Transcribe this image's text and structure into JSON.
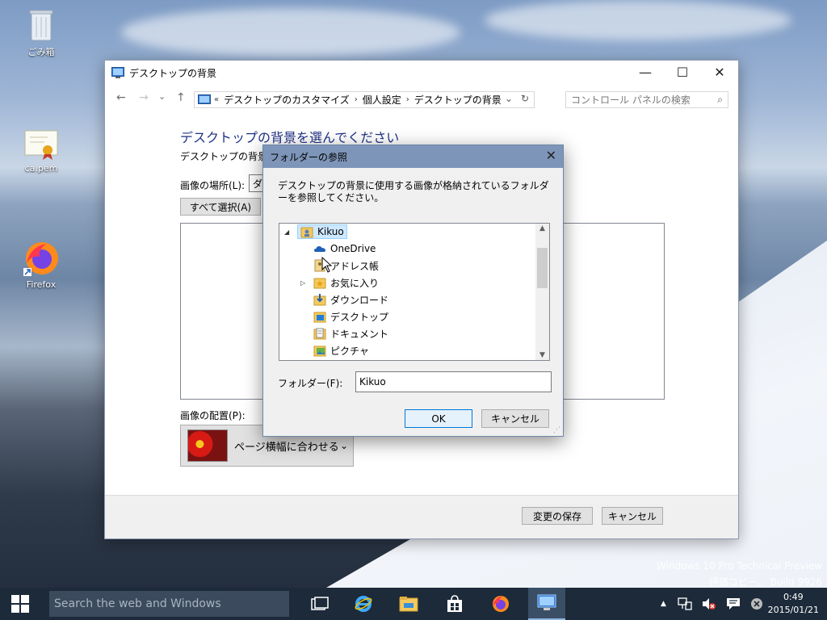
{
  "desktop": {
    "icons": [
      {
        "label": "ごみ箱"
      },
      {
        "label": "ca.pem"
      },
      {
        "label": "Firefox"
      }
    ],
    "watermark": {
      "line1": "Windows 10 Pro Technical Preview",
      "line2": "評価コピー。 Build 9926"
    }
  },
  "window": {
    "title": "デスクトップの背景",
    "controls": {
      "minimize": "—",
      "maximize": "☐",
      "close": "✕"
    },
    "nav": {
      "back": "←",
      "forward": "→",
      "recent": "⌄",
      "up": "↑"
    },
    "breadcrumb": {
      "prefix": "«",
      "items": [
        "デスクトップのカスタマイズ",
        "個人設定",
        "デスクトップの背景"
      ],
      "dropdown": "⌄",
      "refresh": "↻"
    },
    "search": {
      "placeholder": "コントロール パネルの検索",
      "icon": "⌕"
    },
    "heading": "デスクトップの背景を選んでください",
    "subtext": "デスクトップの背景にす",
    "location_label": "画像の場所(L):",
    "location_value": "ダ",
    "select_all": "すべて選択(A)",
    "position_label": "画像の配置(P):",
    "position_value": "ページ横幅に合わせる",
    "position_arrow": "⌄",
    "save_button": "変更の保存",
    "cancel_button": "キャンセル"
  },
  "dialog": {
    "title": "フォルダーの参照",
    "close": "✕",
    "description": "デスクトップの背景に使用する画像が格納されているフォルダーを参照してください。",
    "tree": {
      "root": {
        "label": "Kikuo",
        "expander": "◢"
      },
      "items": [
        {
          "label": "OneDrive",
          "expander": ""
        },
        {
          "label": "アドレス帳",
          "expander": ""
        },
        {
          "label": "お気に入り",
          "expander": "▷"
        },
        {
          "label": "ダウンロード",
          "expander": ""
        },
        {
          "label": "デスクトップ",
          "expander": ""
        },
        {
          "label": "ドキュメント",
          "expander": ""
        },
        {
          "label": "ピクチャ",
          "expander": ""
        }
      ],
      "scroll_up": "▲",
      "scroll_down": "▼"
    },
    "folder_label": "フォルダー(F):",
    "folder_value": "Kikuo",
    "ok": "OK",
    "cancel": "キャンセル"
  },
  "taskbar": {
    "search_placeholder": "Search the web and Windows",
    "tray_expand": "▲",
    "clock_time": "0:49",
    "clock_date": "2015/01/21"
  },
  "colors": {
    "accent": "#0078d7",
    "heading": "#1e3287",
    "dialog_title": "#7d95b8",
    "taskbar": "#1c2a3a"
  }
}
